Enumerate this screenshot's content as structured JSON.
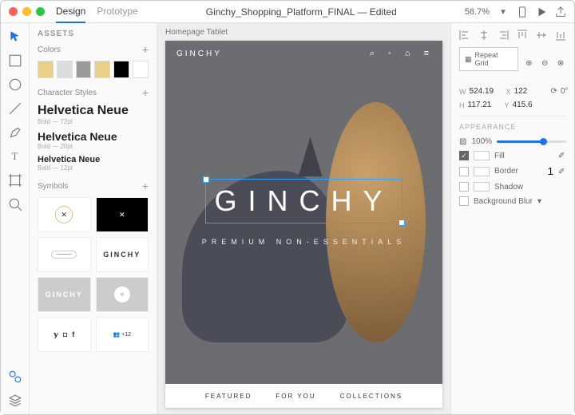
{
  "titlebar": {
    "tabs": [
      "Design",
      "Prototype"
    ],
    "active": 0,
    "doc": "Ginchy_Shopping_Platform_FINAL  —  Edited",
    "zoom": "58.7%"
  },
  "assets": {
    "title": "ASSETS",
    "colors": {
      "label": "Colors",
      "items": [
        "#e9cf8a",
        "#dcdcdc",
        "#9a9a9a",
        "#e9cf8a",
        "#000000",
        "#ffffff"
      ]
    },
    "charstyles": {
      "label": "Character Styles",
      "items": [
        {
          "name": "Helvetica Neue",
          "meta": "Bold — 72pt",
          "size": 16
        },
        {
          "name": "Helvetica Neue",
          "meta": "Bold — 20pt",
          "size": 14
        },
        {
          "name": "Helvetica Neue",
          "meta": "Bold — 12pt",
          "size": 11
        }
      ]
    },
    "symbols": {
      "label": "Symbols",
      "items": [
        "circle-x",
        "square-x",
        "badge",
        "ginchy-logo",
        "ginchy-grey",
        "heart-circle",
        "social",
        "avatars"
      ]
    }
  },
  "canvas": {
    "artboard_label": "Homepage Tablet",
    "brand": "GINCHY",
    "hero_logo": "GINCHY",
    "tagline": "PREMIUM   NON-ESSENTIALS",
    "nav": [
      "FEATURED",
      "FOR YOU",
      "COLLECTIONS"
    ]
  },
  "props": {
    "repeat": "Repeat Grid",
    "w": "524.19",
    "x": "122",
    "rot": "0°",
    "h": "117.21",
    "y": "415.6",
    "appearance": "APPEARANCE",
    "opacity": "100%",
    "fill": "Fill",
    "border": "Border",
    "border_w": "1",
    "shadow": "Shadow",
    "blur": "Background Blur"
  }
}
